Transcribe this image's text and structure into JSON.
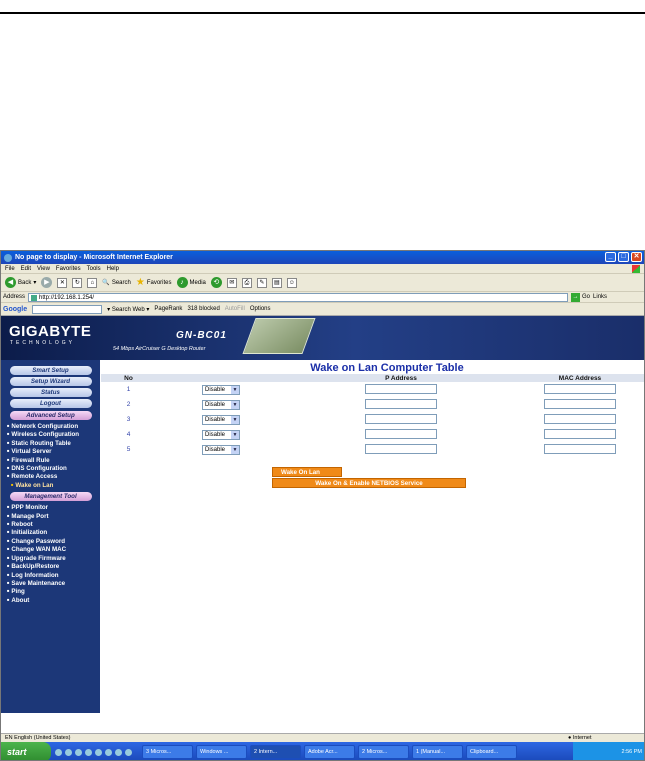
{
  "browser": {
    "title": "No page to display - Microsoft Internet Explorer",
    "menu": [
      "File",
      "Edit",
      "View",
      "Favorites",
      "Tools",
      "Help"
    ],
    "toolbar": {
      "back": "Back",
      "search": "Search",
      "favorites": "Favorites",
      "media": "Media"
    },
    "address_label": "Address",
    "address": "http://192.168.1.254/",
    "go": "Go",
    "links": "Links",
    "google": {
      "logo": "Google",
      "search_web": "Search Web",
      "pagerank": "PageRank",
      "blocked": "318 blocked",
      "autofill": "AutoFill",
      "options": "Options"
    }
  },
  "router": {
    "brand": "GIGABYTE",
    "brand_sub": "TECHNOLOGY",
    "model": "GN-BC01",
    "model_sub": "54 Mbps AirCruiser G Desktop Router"
  },
  "sidebar": {
    "buttons": [
      "Smart Setup",
      "Setup Wizard",
      "Status",
      "Logout"
    ],
    "advanced_head": "Advanced Setup",
    "advanced_items": [
      "Network Configuration",
      "Wireless Configuration",
      "Static Routing Table",
      "Virtual Server",
      "Firewall Rule",
      "DNS Configuration",
      "Remote Access"
    ],
    "advanced_sub": "Wake on Lan",
    "mgmt_head": "Management Tool",
    "mgmt_items": [
      "PPP Monitor",
      "Manage Port",
      "Reboot",
      "Initialization",
      "Change Password",
      "Change WAN MAC",
      "Upgrade Firmware",
      "BackUp/Restore",
      "Log Information",
      "Save Maintenance",
      "Ping",
      "About"
    ]
  },
  "main": {
    "title": "Wake on Lan Computer Table",
    "headers": {
      "no": "No",
      "ip": "P Address",
      "mac": "MAC Address"
    },
    "rows": [
      {
        "no": "1",
        "status": "Disable"
      },
      {
        "no": "2",
        "status": "Disable"
      },
      {
        "no": "3",
        "status": "Disable"
      },
      {
        "no": "4",
        "status": "Disable"
      },
      {
        "no": "5",
        "status": "Disable"
      }
    ],
    "wake_button": "Wake On Lan",
    "wake_netbios_button": "Wake On & Enable NETBIOS Service"
  },
  "statusbar": {
    "language": "EN English (United States)",
    "zone": "Internet"
  },
  "taskbar": {
    "start": "start",
    "tasks": [
      "3 Micros...",
      "Windows ...",
      "2 Intern...",
      "Adobe Acr...",
      "2 Micros...",
      "1 (Manual...",
      "Clipboard..."
    ],
    "time": "2:56 PM"
  }
}
